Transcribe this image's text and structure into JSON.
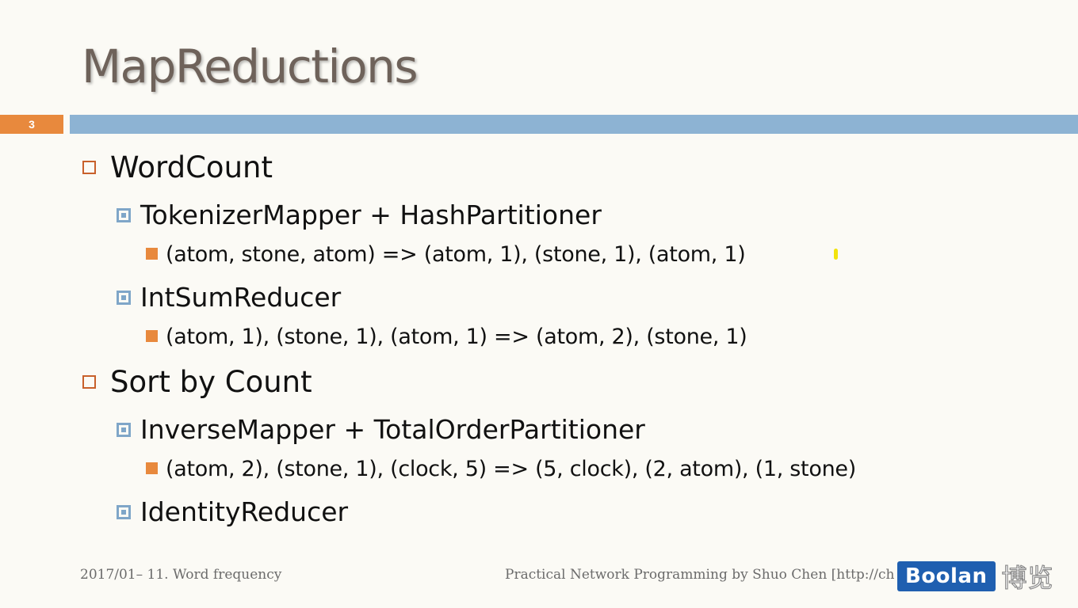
{
  "slide": {
    "title": "MapReductions",
    "number": "3"
  },
  "bullets": {
    "wordcount": {
      "label": "WordCount",
      "mapper": "TokenizerMapper + HashPartitioner",
      "mapper_example": "(atom, stone, atom) => (atom, 1), (stone, 1), (atom, 1)",
      "reducer": "IntSumReducer",
      "reducer_example": "(atom, 1), (stone, 1), (atom, 1) => (atom, 2), (stone, 1)"
    },
    "sort": {
      "label": "Sort by Count",
      "mapper": "InverseMapper + TotalOrderPartitioner",
      "mapper_example": "(atom, 2), (stone, 1), (clock, 5) => (5, clock), (2, atom), (1, stone)",
      "reducer": "IdentityReducer"
    }
  },
  "footer": {
    "left": "2017/01– 11. Word frequency",
    "right": "Practical Network Programming by Shuo Chen [http://ch"
  },
  "watermark": {
    "brand": "Boolan",
    "chinese": "博览"
  },
  "colors": {
    "accent_orange": "#e8893d",
    "accent_blue": "#8db3d3",
    "title": "#6e625a",
    "watermark_blue": "#1f5fb0"
  }
}
